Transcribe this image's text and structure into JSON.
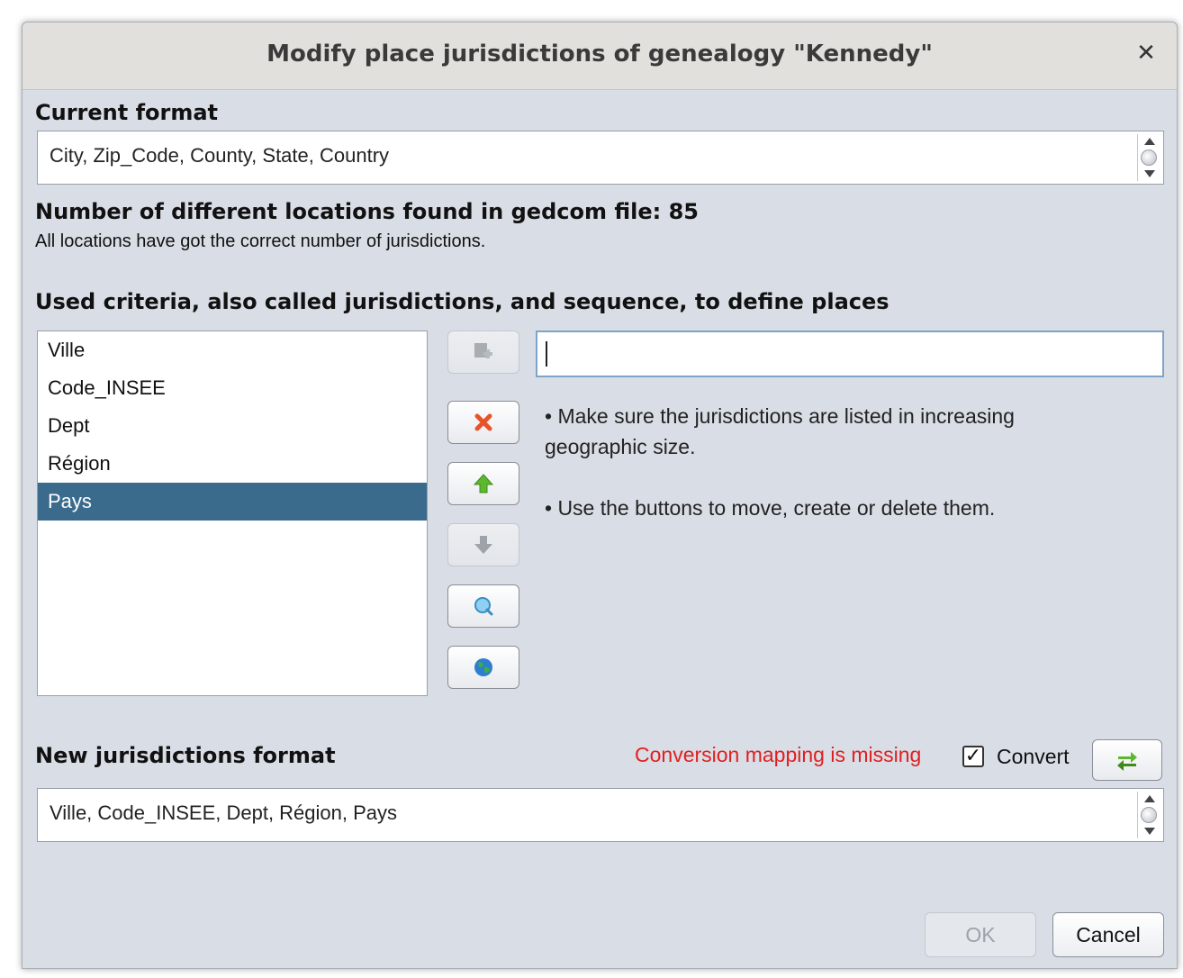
{
  "window": {
    "title": "Modify place jurisdictions of genealogy \"Kennedy\"",
    "close_label": "✕"
  },
  "current": {
    "heading": "Current format",
    "value": "City, Zip_Code, County, State, Country"
  },
  "stats": {
    "heading": "Number of different locations found in gedcom file: 85",
    "message": "All locations have got the correct number of jurisdictions."
  },
  "criteria": {
    "heading": "Used criteria, also called jurisdictions, and sequence, to define places",
    "items": [
      "Ville",
      "Code_INSEE",
      "Dept",
      "Région",
      "Pays"
    ],
    "selected": "Pays",
    "input_value": "",
    "hints": [
      "• Make sure the jurisdictions are listed in increasing geographic size.",
      "• Use the buttons to move, create or delete them."
    ]
  },
  "newformat": {
    "heading": "New jurisdictions format",
    "warning": "Conversion mapping is missing",
    "convert_label": "Convert",
    "convert_checked": "✓",
    "value": "Ville, Code_INSEE, Dept, Région, Pays"
  },
  "footer": {
    "ok_label": "OK",
    "cancel_label": "Cancel"
  },
  "colors": {
    "selection": "#3a6b8d",
    "warning": "#e02020",
    "dialog_bg": "#d9dde5"
  }
}
